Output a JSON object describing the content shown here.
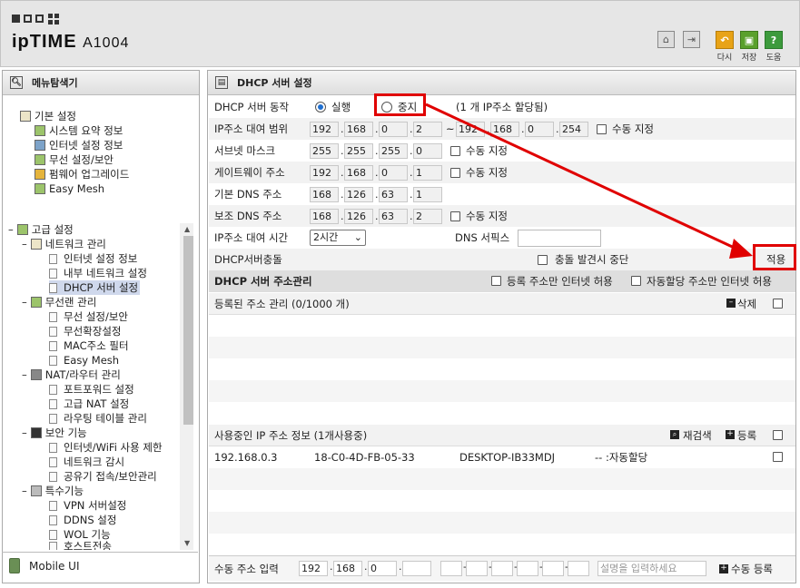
{
  "header": {
    "brand": "ipTIME",
    "model": "A1004",
    "buttons": [
      {
        "label": "다시",
        "icon": "undo-icon",
        "color": "#e8a317"
      },
      {
        "label": "저장",
        "icon": "save-icon",
        "color": "#5aa02c"
      },
      {
        "label": "도움",
        "icon": "help-icon",
        "color": "#3c9a3c"
      }
    ],
    "tool_icons": [
      "home-icon",
      "logout-icon"
    ]
  },
  "left": {
    "title": "메뉴탐색기",
    "basic": {
      "label": "기본 설정",
      "items": [
        "시스템 요약 정보",
        "인터넷 설정 정보",
        "무선 설정/보안",
        "펌웨어 업그레이드",
        "Easy Mesh"
      ]
    },
    "advanced": {
      "label": "고급 설정",
      "groups": [
        {
          "label": "네트워크 관리",
          "items": [
            "인터넷 설정 정보",
            "내부 네트워크 설정",
            "DHCP 서버 설정"
          ]
        },
        {
          "label": "무선랜 관리",
          "items": [
            "무선 설정/보안",
            "무선확장설정",
            "MAC주소 필터",
            "Easy Mesh"
          ]
        },
        {
          "label": "NAT/라우터 관리",
          "items": [
            "포트포워드 설정",
            "고급 NAT 설정",
            "라우팅 테이블 관리"
          ]
        },
        {
          "label": "보안 기능",
          "items": [
            "인터넷/WiFi 사용 제한",
            "네트워크 감시",
            "공유기 접속/보안관리"
          ]
        },
        {
          "label": "특수기능",
          "items": [
            "VPN 서버설정",
            "DDNS 설정",
            "WOL 기능",
            "호스트전송"
          ]
        }
      ]
    },
    "mobile": "Mobile UI"
  },
  "right": {
    "title": "DHCP 서버 설정",
    "action": {
      "label": "DHCP 서버 동작",
      "run": "실행",
      "stop": "중지",
      "note": "(1 개 IP주소 할당됨)"
    },
    "range": {
      "label": "IP주소 대여 범위",
      "start": [
        "192",
        "168",
        "0",
        "2"
      ],
      "tilde": "~",
      "end": [
        "192",
        "168",
        "0",
        "254"
      ],
      "manual": "수동 지정"
    },
    "subnet": {
      "label": "서브넷 마스크",
      "value": [
        "255",
        "255",
        "255",
        "0"
      ],
      "manual": "수동 지정"
    },
    "gateway": {
      "label": "게이트웨이 주소",
      "value": [
        "192",
        "168",
        "0",
        "1"
      ],
      "manual": "수동 지정"
    },
    "dns1": {
      "label": "기본 DNS 주소",
      "value": [
        "168",
        "126",
        "63",
        "1"
      ]
    },
    "dns2": {
      "label": "보조 DNS 주소",
      "value": [
        "168",
        "126",
        "63",
        "2"
      ],
      "manual": "수동 지정"
    },
    "lease": {
      "label": "IP주소 대여 시간",
      "value": "2시간",
      "dns_suffix": "DNS 서픽스"
    },
    "conflict": {
      "label": "DHCP서버충돌",
      "stop_on_conflict": "충돌 발견시 중단",
      "apply": "적용"
    },
    "addr_mgmt": {
      "title": "DHCP 서버 주소관리",
      "reg_only": "등록 주소만 인터넷 허용",
      "auto_allow": "자동할당 주소만 인터넷 허용"
    },
    "registered": {
      "title": "등록된 주소 관리 (0/1000 개)",
      "delete": "삭제"
    },
    "in_use": {
      "title": "사용중인 IP 주소 정보 (1개사용중)",
      "rescan": "재검색",
      "register": "등록",
      "rows": [
        {
          "ip": "192.168.0.3",
          "mac": "18-C0-4D-FB-05-33",
          "name": "DESKTOP-IB33MDJ",
          "type": "-- :자동할당"
        }
      ]
    },
    "manual_input": {
      "label": "수동 주소 입력",
      "ip": [
        "192",
        "168",
        "0",
        ""
      ],
      "desc_placeholder": "설명을 입력하세요",
      "button": "수동 등록"
    }
  }
}
